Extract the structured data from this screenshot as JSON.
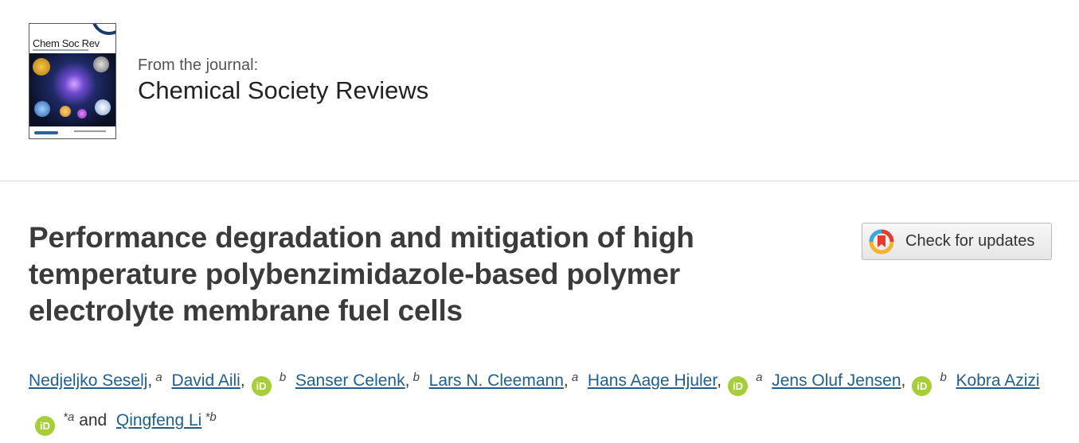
{
  "journal": {
    "cover_title": "Chem Soc Rev",
    "from_label": "From the journal:",
    "name": "Chemical Society Reviews"
  },
  "article": {
    "title": "Performance degradation and mitigation of high temperature polybenzimidazole-based polymer electrolyte membrane fuel cells",
    "check_updates_label": "Check for updates"
  },
  "authors": [
    {
      "name": "Nedjeljko Seselj",
      "orcid": false,
      "mark": "a",
      "corresponding": false
    },
    {
      "name": "David Aili",
      "orcid": true,
      "mark": "b",
      "corresponding": false
    },
    {
      "name": "Sanser Celenk",
      "orcid": false,
      "mark": "b",
      "corresponding": false
    },
    {
      "name": "Lars N. Cleemann",
      "orcid": false,
      "mark": "a",
      "corresponding": false
    },
    {
      "name": "Hans Aage Hjuler",
      "orcid": true,
      "mark": "a",
      "corresponding": false
    },
    {
      "name": "Jens Oluf Jensen",
      "orcid": true,
      "mark": "b",
      "corresponding": false
    },
    {
      "name": "Kobra Azizi",
      "orcid": true,
      "mark": "a",
      "corresponding": true
    },
    {
      "name": "Qingfeng Li",
      "orcid": false,
      "mark": "b",
      "corresponding": true
    }
  ],
  "authors_text": {
    "comma": ",",
    "and": "and",
    "orcid_icon_text": "iD",
    "corresponding_mark": "*"
  },
  "colors": {
    "link": "#1f5e8f",
    "orcid": "#a6ce39",
    "title": "#3b3b3b"
  }
}
